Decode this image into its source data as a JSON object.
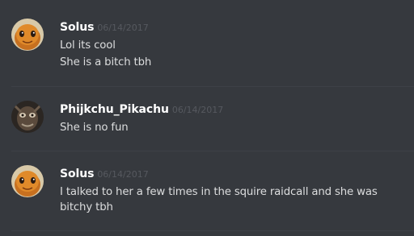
{
  "messages": [
    {
      "author": "Solus",
      "timestamp": "06/14/2017",
      "avatar": "charmander-avatar",
      "lines": [
        "Lol its cool",
        "She is a bitch tbh"
      ]
    },
    {
      "author": "Phijkchu_Pikachu",
      "timestamp": "06/14/2017",
      "avatar": "dark-face-avatar",
      "lines": [
        "She is no fun"
      ]
    },
    {
      "author": "Solus",
      "timestamp": "06/14/2017",
      "avatar": "charmander-avatar",
      "lines": [
        "I talked to her a few times in the squire raidcall and she was",
        "bitchy tbh"
      ]
    }
  ],
  "colors": {
    "background": "#36393e",
    "divider": "#3e4147",
    "username": "#ffffff",
    "timestamp": "#56595f",
    "message_text": "#dcddde"
  }
}
